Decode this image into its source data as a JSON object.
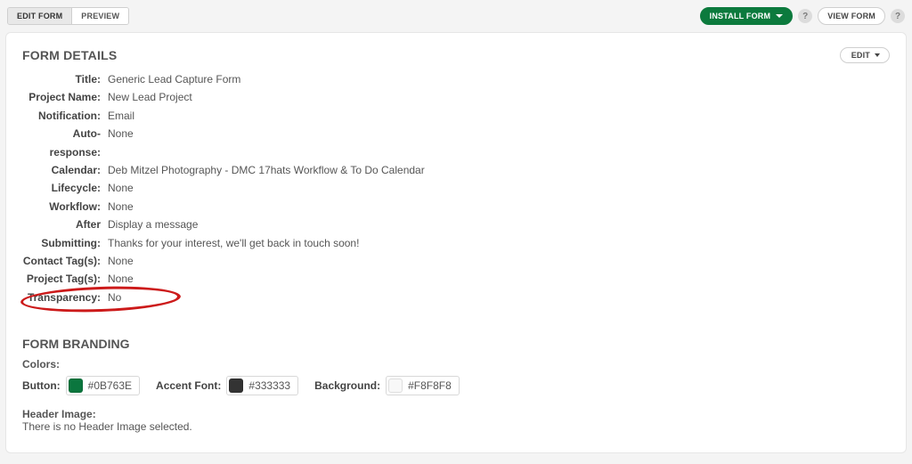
{
  "topbar": {
    "tab_edit": "EDIT FORM",
    "tab_preview": "PREVIEW",
    "install_label": "INSTALL FORM",
    "help_glyph": "?",
    "view_form_label": "VIEW FORM"
  },
  "section_details_title": "FORM DETAILS",
  "edit_button_label": "EDIT",
  "details": [
    {
      "label": "Title:",
      "value": "Generic Lead Capture Form"
    },
    {
      "label": "Project Name:",
      "value": "New Lead Project"
    },
    {
      "label": "Notification:",
      "value": "Email"
    },
    {
      "label": "Auto-response:",
      "value": "None"
    },
    {
      "label": "Calendar:",
      "value": "Deb Mitzel Photography - DMC 17hats Workflow & To Do Calendar"
    },
    {
      "label": "Lifecycle:",
      "value": "None"
    },
    {
      "label": "Workflow:",
      "value": "None"
    },
    {
      "label": "After Submitting:",
      "value": "Display a message\nThanks for your interest, we'll get back in touch soon!"
    },
    {
      "label": "Contact Tag(s):",
      "value": "None"
    },
    {
      "label": "Project Tag(s):",
      "value": "None"
    },
    {
      "label": "Transparency:",
      "value": "No"
    }
  ],
  "branding": {
    "section_title": "FORM BRANDING",
    "colors_label": "Colors:",
    "button_label": "Button:",
    "button_color": "#0B763E",
    "accent_label": "Accent Font:",
    "accent_color": "#333333",
    "background_label": "Background:",
    "background_color": "#F8F8F8",
    "header_image_label": "Header Image:",
    "header_image_note": "There is no Header Image selected."
  }
}
